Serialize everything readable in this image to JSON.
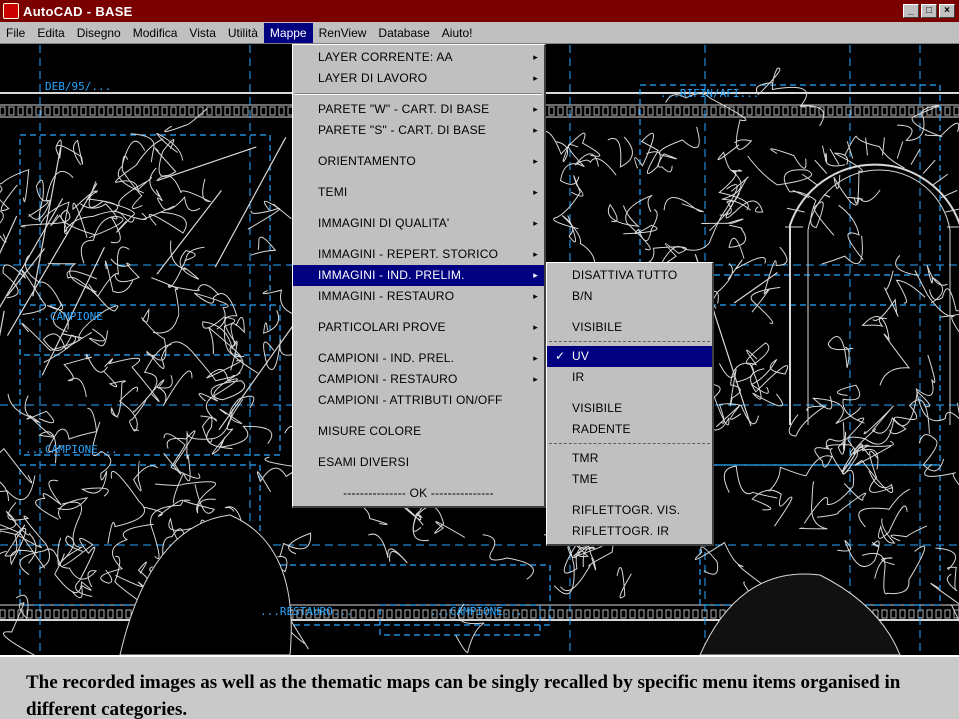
{
  "window": {
    "title": "AutoCAD - BASE",
    "buttons": {
      "minimize": "_",
      "maximize": "□",
      "close": "×"
    }
  },
  "menubar": {
    "items": [
      "File",
      "Edita",
      "Disegno",
      "Modifica",
      "Vista",
      "Utilità",
      "Mappe",
      "RenView",
      "Database",
      "Aiuto!"
    ],
    "active": "Mappe"
  },
  "canvas": {
    "labels": [
      "DEB/95/...",
      "...RIFIN/AFI...",
      "...CAMPIONE",
      "...IMMAGINE...",
      "...CAMPIONE...",
      "...RESTAURO...",
      "...CAMPIONE..."
    ]
  },
  "mappe_menu": {
    "items": [
      {
        "label": "LAYER CORRENTE: AA",
        "submenu": true
      },
      {
        "label": "LAYER DI LAVORO",
        "submenu": true
      },
      {
        "type": "separator"
      },
      {
        "label": "PARETE \"W\" - CART. DI BASE",
        "submenu": true
      },
      {
        "label": "PARETE \"S\" - CART. DI BASE",
        "submenu": true
      },
      {
        "type": "gap"
      },
      {
        "label": "ORIENTAMENTO",
        "submenu": true
      },
      {
        "type": "gap"
      },
      {
        "label": "TEMI",
        "submenu": true
      },
      {
        "type": "gap"
      },
      {
        "label": "IMMAGINI DI QUALITA'",
        "submenu": true
      },
      {
        "type": "gap"
      },
      {
        "label": "IMMAGINI - REPERT. STORICO",
        "submenu": true
      },
      {
        "label": "IMMAGINI - IND. PRELIM.",
        "submenu": true,
        "selected": true
      },
      {
        "label": "IMMAGINI - RESTAURO",
        "submenu": true
      },
      {
        "type": "gap"
      },
      {
        "label": "PARTICOLARI PROVE",
        "submenu": true
      },
      {
        "type": "gap"
      },
      {
        "label": "CAMPIONI - IND. PREL.",
        "submenu": true
      },
      {
        "label": "CAMPIONI - RESTAURO",
        "submenu": true
      },
      {
        "label": "CAMPIONI - ATTRIBUTI ON/OFF",
        "submenu": false
      },
      {
        "type": "gap"
      },
      {
        "label": "MISURE COLORE",
        "submenu": false
      },
      {
        "type": "gap"
      },
      {
        "label": "ESAMI DIVERSI",
        "submenu": false
      },
      {
        "type": "gap"
      },
      {
        "label": "--------------- OK ---------------",
        "submenu": false,
        "ok": true
      }
    ]
  },
  "submenu": {
    "items": [
      {
        "label": "DISATTIVA TUTTO"
      },
      {
        "label": "B/N"
      },
      {
        "type": "gap"
      },
      {
        "label": "VISIBILE"
      },
      {
        "type": "dashsep"
      },
      {
        "label": "UV",
        "selected": true,
        "checked": true
      },
      {
        "label": "IR"
      },
      {
        "type": "gap"
      },
      {
        "label": "VISIBILE"
      },
      {
        "label": "RADENTE"
      },
      {
        "type": "dashsep"
      },
      {
        "label": "TMR"
      },
      {
        "label": "TME"
      },
      {
        "type": "gap"
      },
      {
        "label": "RIFLETTOGR. VIS."
      },
      {
        "label": "RIFLETTOGR. IR"
      }
    ],
    "check_glyph": "✓",
    "arrow_glyph": "▸"
  },
  "caption": {
    "text": "The recorded images as well as the thematic maps can be singly recalled by specific menu  items organised in different categories."
  },
  "colors": {
    "titlebar": "#7a0000",
    "menu_bg": "#c0c0c0",
    "highlight": "#000080",
    "drawing_line": "#d8d8d8",
    "drawing_blue": "#2aa8ff",
    "caption_bg": "#c9c9c9"
  }
}
